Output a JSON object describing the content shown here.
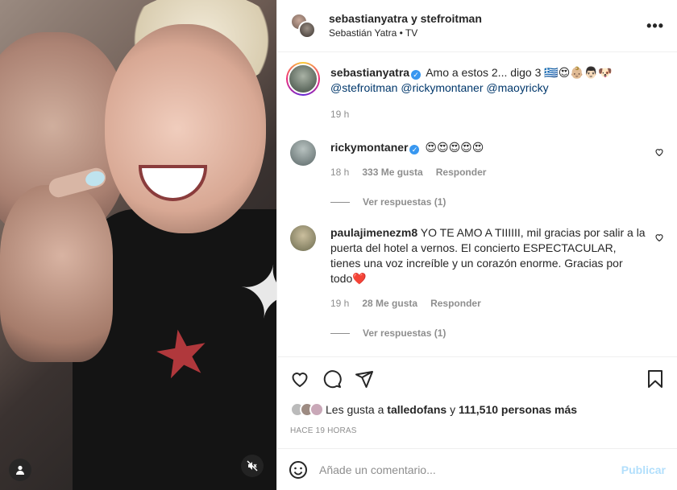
{
  "header": {
    "title_user1": "sebastianyatra",
    "title_connector": "y",
    "title_user2": "stefroitman",
    "subtitle": "Sebastián Yatra • TV",
    "more": "•••"
  },
  "caption": {
    "username": "sebastianyatra",
    "text": "Amo a estos 2... digo 3 🇬🇷😍👶🏼👨🏻🐶",
    "mentions": [
      "@stefroitman",
      "@rickymontaner",
      "@maoyricky"
    ],
    "time": "19 h"
  },
  "comments": [
    {
      "username": "rickymontaner",
      "verified": true,
      "text": "😍😍😍😍😍",
      "time": "18 h",
      "likes": "333 Me gusta",
      "reply": "Responder",
      "view_replies": "Ver respuestas (1)"
    },
    {
      "username": "paulajimenezm8",
      "verified": false,
      "text": "YO TE AMO A TIIIIII, mil gracias por salir a la puerta del hotel a vernos. El concierto ESPECTACULAR, tienes una voz increíble y un corazón enorme. Gracias por todo❤️",
      "time": "19 h",
      "likes": "28 Me gusta",
      "reply": "Responder",
      "view_replies": "Ver respuestas (1)"
    }
  ],
  "likes": {
    "prefix": "Les gusta a",
    "user": "talledofans",
    "connector": "y",
    "count": "111,510 personas más"
  },
  "timestamp": "HACE 19 HORAS",
  "composer": {
    "placeholder": "Añade un comentario...",
    "publish": "Publicar"
  },
  "colors": {
    "link_blue": "#00376b",
    "verified_blue": "#3897f0",
    "publish_disabled": "#b2dffc",
    "muted_gray": "#8e8e8e"
  },
  "icons": [
    "user-tag-icon",
    "mute-icon",
    "heart-icon",
    "comment-icon",
    "share-icon",
    "bookmark-icon",
    "emoji-icon",
    "verified-icon"
  ]
}
